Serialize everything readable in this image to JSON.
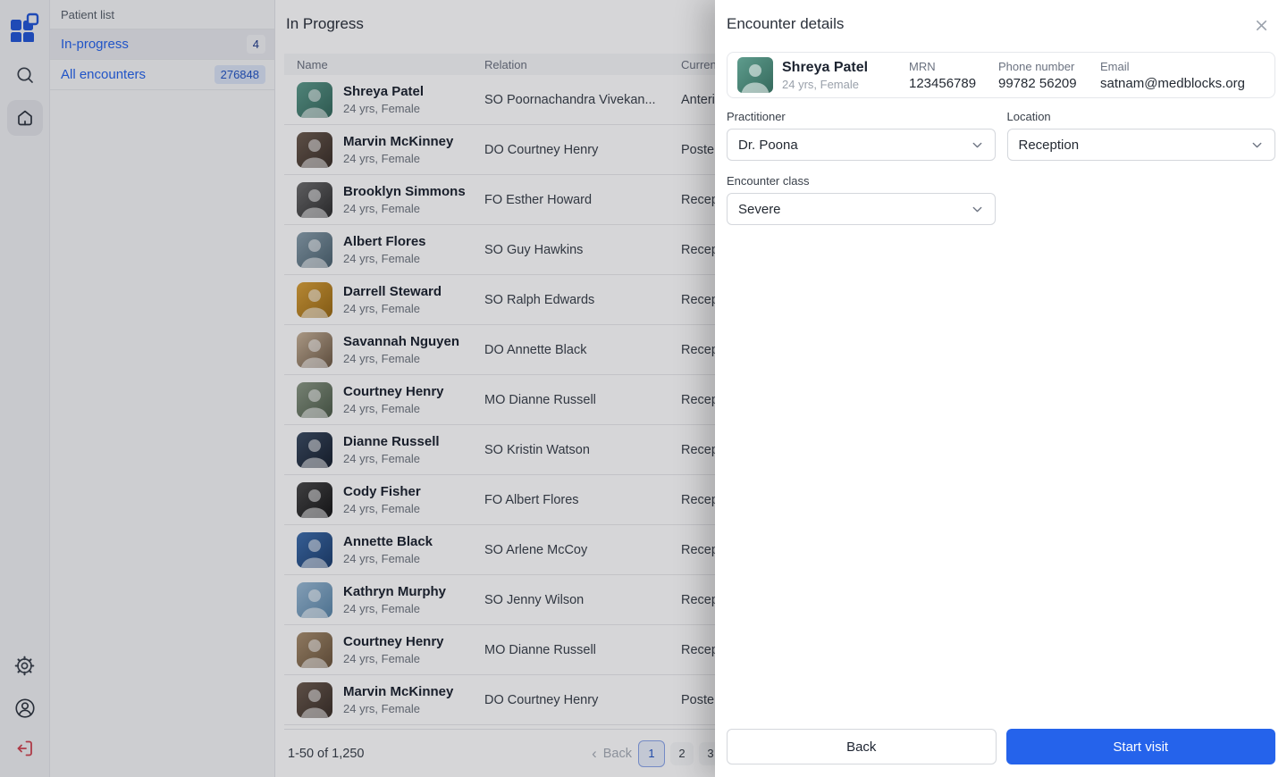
{
  "colors": {
    "accent_blue": "#2563eb",
    "link_blue": "#2563eb",
    "logout_red": "#cf4451",
    "active_page_border": "#8aa4e8",
    "overlay": "rgba(10,14,22,0.17)"
  },
  "sidebar": {
    "icons": [
      "app-logo",
      "search",
      "home",
      "settings",
      "profile",
      "logout"
    ],
    "active_icon": "home"
  },
  "patient_list": {
    "title": "Patient list",
    "items": [
      {
        "label": "In-progress",
        "count": "4",
        "active": true,
        "badge": "plain"
      },
      {
        "label": "All encounters",
        "count": "276848",
        "active": false,
        "badge": "blue"
      }
    ]
  },
  "main": {
    "title": "In Progress",
    "table": {
      "columns": [
        "Name",
        "Relation",
        "Curren"
      ],
      "rows": [
        {
          "name": "Shreya Patel",
          "meta": "24 yrs, Female",
          "relation": "SO Poornachandra Vivekan...",
          "location": "Anteri",
          "avatar": [
            "#5e9c8d",
            "#35695c"
          ]
        },
        {
          "name": "Marvin McKinney",
          "meta": "24 yrs, Female",
          "relation": "DO Courtney Henry",
          "location": "Poste",
          "avatar": [
            "#6e5d50",
            "#3a2f28"
          ]
        },
        {
          "name": "Brooklyn Simmons",
          "meta": "24 yrs, Female",
          "relation": "FO Esther Howard",
          "location": "Recep",
          "avatar": [
            "#6f6f6f",
            "#2e2e2e"
          ]
        },
        {
          "name": "Albert Flores",
          "meta": "24 yrs, Female",
          "relation": "SO Guy Hawkins",
          "location": "Recep",
          "avatar": [
            "#8aa0ad",
            "#4c6370"
          ]
        },
        {
          "name": "Darrell Steward",
          "meta": "24 yrs, Female",
          "relation": "SO Ralph Edwards",
          "location": "Recep",
          "avatar": [
            "#d9a13a",
            "#9a6a14"
          ]
        },
        {
          "name": "Savannah Nguyen",
          "meta": "24 yrs, Female",
          "relation": "DO Annette Black",
          "location": "Recep",
          "avatar": [
            "#c9b49a",
            "#6e5a45"
          ]
        },
        {
          "name": "Courtney Henry",
          "meta": "24 yrs, Female",
          "relation": "MO Dianne Russell",
          "location": "Recep",
          "avatar": [
            "#8c9a86",
            "#4d5c49"
          ]
        },
        {
          "name": "Dianne Russell",
          "meta": "24 yrs, Female",
          "relation": "SO Kristin Watson",
          "location": "Recep",
          "avatar": [
            "#3c4d63",
            "#17202e"
          ]
        },
        {
          "name": "Cody Fisher",
          "meta": "24 yrs, Female",
          "relation": "FO Albert Flores",
          "location": "Recep",
          "avatar": [
            "#4a4a4a",
            "#161616"
          ]
        },
        {
          "name": "Annette Black",
          "meta": "24 yrs, Female",
          "relation": "SO Arlene McCoy",
          "location": "Recep",
          "avatar": [
            "#3f6fae",
            "#1d3f6e"
          ]
        },
        {
          "name": "Kathryn Murphy",
          "meta": "24 yrs, Female",
          "relation": "SO Jenny Wilson",
          "location": "Recep",
          "avatar": [
            "#9cbcd6",
            "#5a86a8"
          ]
        },
        {
          "name": "Courtney Henry",
          "meta": "24 yrs, Female",
          "relation": "MO Dianne Russell",
          "location": "Recep",
          "avatar": [
            "#a98f6f",
            "#6b553c"
          ]
        },
        {
          "name": "Marvin McKinney",
          "meta": "24 yrs, Female",
          "relation": "DO Courtney Henry",
          "location": "Poste",
          "avatar": [
            "#6e5d50",
            "#3a2f28"
          ]
        }
      ]
    },
    "pagination": {
      "range": "1-50 of 1,250",
      "back_label": "Back",
      "pages": [
        "1",
        "2",
        "3"
      ],
      "active_page": "1"
    }
  },
  "drawer": {
    "title": "Encounter details",
    "patient": {
      "name": "Shreya Patel",
      "meta": "24 yrs, Female",
      "avatar": [
        "#5e9c8d",
        "#35695c"
      ],
      "fields": [
        {
          "label": "MRN",
          "value": "123456789"
        },
        {
          "label": "Phone number",
          "value": "99782 56209"
        },
        {
          "label": "Email",
          "value": "satnam@medblocks.org"
        }
      ]
    },
    "fields": [
      {
        "label": "Practitioner",
        "value": "Dr. Poona"
      },
      {
        "label": "Location",
        "value": "Reception"
      },
      {
        "label": "Encounter class",
        "value": "Severe"
      }
    ],
    "footer": {
      "back_label": "Back",
      "submit_label": "Start visit"
    }
  }
}
